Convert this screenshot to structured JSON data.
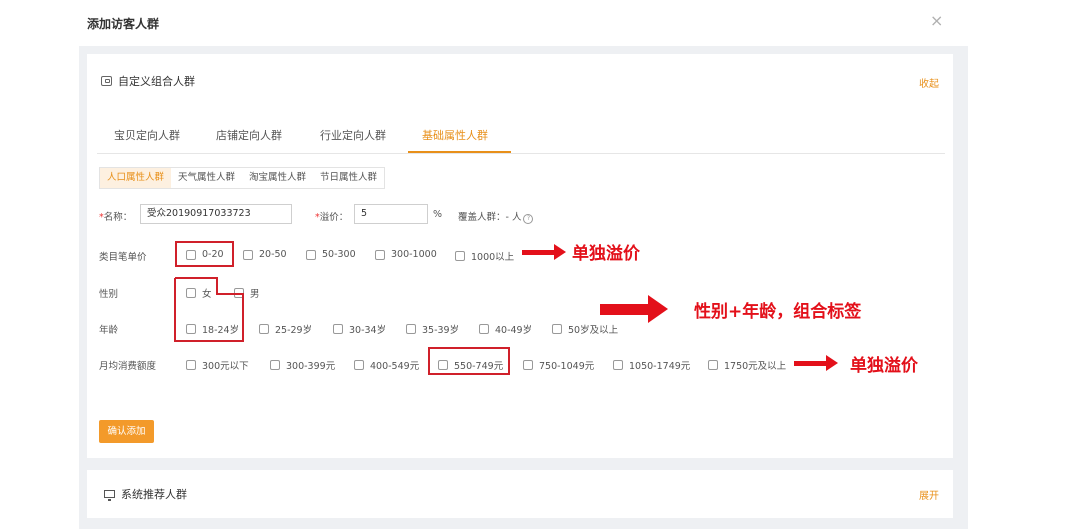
{
  "modal": {
    "title": "添加访客人群",
    "close": "×"
  },
  "custom_section": {
    "title": "自定义组合人群",
    "toggle": "收起"
  },
  "tabs": [
    "宝贝定向人群",
    "店铺定向人群",
    "行业定向人群",
    "基础属性人群"
  ],
  "subtabs": [
    "人口属性人群",
    "天气属性人群",
    "淘宝属性人群",
    "节日属性人群"
  ],
  "form": {
    "name_label": "名称：",
    "name_value": "受众20190917033723",
    "premium_label": "溢价：",
    "premium_value": "5",
    "percent": "%",
    "coverage_label": "覆盖人群：",
    "coverage_value": "- 人",
    "required_mark": "*"
  },
  "rows": {
    "price": {
      "label": "类目笔单价",
      "options": [
        "0-20",
        "20-50",
        "50-300",
        "300-1000",
        "1000以上"
      ]
    },
    "gender": {
      "label": "性别",
      "options": [
        "女",
        "男"
      ]
    },
    "age": {
      "label": "年龄",
      "options": [
        "18-24岁",
        "25-29岁",
        "30-34岁",
        "35-39岁",
        "40-49岁",
        "50岁及以上"
      ]
    },
    "spending": {
      "label": "月均消费额度",
      "options": [
        "300元以下",
        "300-399元",
        "400-549元",
        "550-749元",
        "750-1049元",
        "1050-1749元",
        "1750元及以上"
      ]
    }
  },
  "annotations": {
    "price": "单独溢价",
    "gender_age": "性别+年龄，组合标签",
    "spending": "单独溢价"
  },
  "confirm_button": "确认添加",
  "system_section": {
    "title": "系统推荐人群",
    "toggle": "展开"
  },
  "colors": {
    "accent": "#e8901a",
    "button": "#f39a2a",
    "annotation": "#e3101a"
  }
}
